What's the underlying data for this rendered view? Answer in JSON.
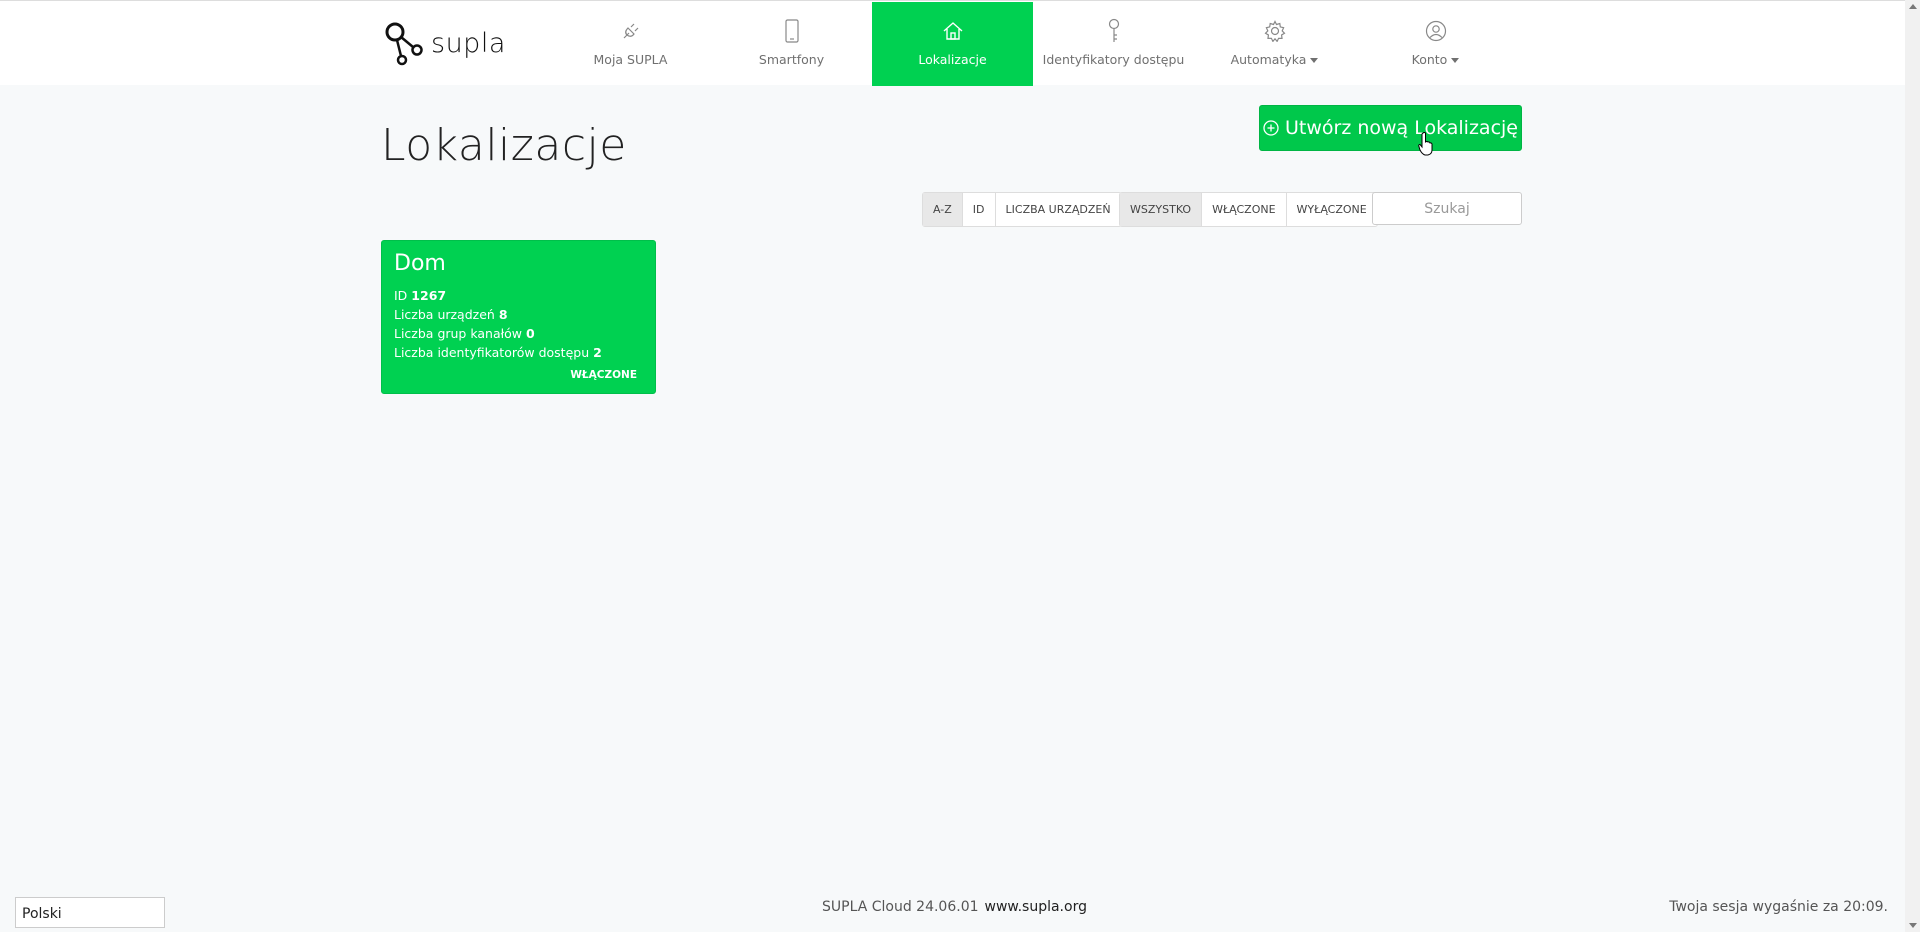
{
  "brand": {
    "name": "supla"
  },
  "nav": [
    {
      "label": "Moja SUPLA",
      "icon": "plug-icon"
    },
    {
      "label": "Smartfony",
      "icon": "smartphone-icon"
    },
    {
      "label": "Lokalizacje",
      "icon": "home-icon",
      "active": true
    },
    {
      "label": "Identyfikatory dostępu",
      "icon": "key-icon"
    },
    {
      "label": "Automatyka",
      "icon": "gear-icon",
      "dropdown": true
    },
    {
      "label": "Konto",
      "icon": "user-icon",
      "dropdown": true
    }
  ],
  "page": {
    "title": "Lokalizacje",
    "create_button": "Utwórz nową Lokalizację"
  },
  "sort_buttons": [
    "A-Z",
    "ID",
    "LICZBA URZĄDZEŃ"
  ],
  "filter_buttons": [
    "WSZYSTKO",
    "WŁĄCZONE",
    "WYŁĄCZONE"
  ],
  "search": {
    "placeholder": "Szukaj",
    "value": ""
  },
  "locations": [
    {
      "name": "Dom",
      "id_label": "ID",
      "id": "1267",
      "devices_label": "Liczba urządzeń",
      "devices": "8",
      "groups_label": "Liczba grup kanałów",
      "groups": "0",
      "access_ids_label": "Liczba identyfikatorów dostępu",
      "access_ids": "2",
      "status": "WŁĄCZONE"
    }
  ],
  "footer": {
    "language": "Polski",
    "version": "SUPLA Cloud 24.06.01",
    "link": "www.supla.org",
    "session": "Twoja sesja wygaśnie za 20:09."
  },
  "colors": {
    "accent": "#00d151",
    "button": "#00c84b"
  }
}
